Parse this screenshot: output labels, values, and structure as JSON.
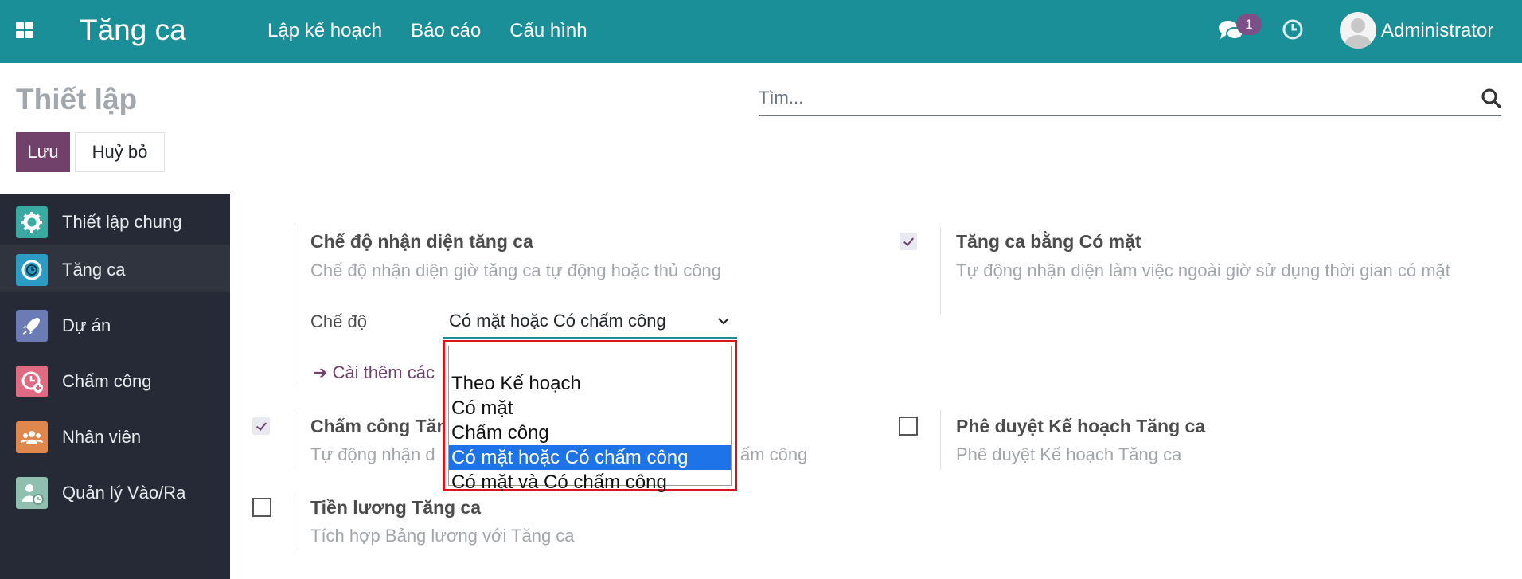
{
  "navbar": {
    "app_title": "Tăng ca",
    "menu": [
      "Lập kế hoạch",
      "Báo cáo",
      "Cấu hình"
    ],
    "chat_badge_count": "1",
    "user_name": "Administrator",
    "color": "#1b8f97"
  },
  "control_panel": {
    "title": "Thiết lập",
    "search_placeholder": "Tìm...",
    "save_label": "Lưu",
    "discard_label": "Huỷ bỏ"
  },
  "sidebar": {
    "items": [
      {
        "label": "Thiết lập chung",
        "icon": "gear-icon",
        "color": "#3aa9a2"
      },
      {
        "label": "Tăng ca",
        "icon": "overtime-clock-icon",
        "color": "#2c9cc4"
      },
      {
        "label": "Dự án",
        "icon": "rocket-icon",
        "color": "#6b7bb5"
      },
      {
        "label": "Chấm công",
        "icon": "timesheet-icon",
        "color": "#e06a82"
      },
      {
        "label": "Nhân viên",
        "icon": "employees-icon",
        "color": "#e0874d"
      },
      {
        "label": "Quản lý Vào/Ra",
        "icon": "attendance-icon",
        "color": "#8fbfae"
      }
    ],
    "active": "Tăng ca"
  },
  "settings": {
    "recognition_mode": {
      "title": "Chế độ nhận diện tăng ca",
      "description": "Chế độ nhận diện giờ tăng ca tự động hoặc thủ công",
      "field_label": "Chế độ",
      "selected_value": "Có mặt hoặc Có chấm công",
      "link_text": "Cài thêm các"
    },
    "overtime_by_attendance": {
      "title": "Tăng ca bằng Có mặt",
      "description": "Tự động nhận diện làm việc ngoài giờ sử dụng thời gian có mặt",
      "checked": true
    },
    "overtime_by_timesheet": {
      "title": "Chấm công Tăng",
      "description_left": "Tự động nhận d",
      "description_right": "ấm công",
      "checked": true
    },
    "approve_plan": {
      "title": "Phê duyệt Kế hoạch Tăng ca",
      "description": "Phê duyệt Kế hoạch Tăng ca",
      "checked": false
    },
    "payroll": {
      "title": "Tiền lương Tăng ca",
      "description": "Tích hợp Bảng lương với Tăng ca",
      "checked": false
    }
  },
  "dropdown": {
    "options": [
      "",
      "Theo Kế hoạch",
      "Có mặt",
      "Chấm công",
      "Có mặt hoặc Có chấm công",
      "Có mặt và Có chấm công"
    ],
    "selected_index": 4,
    "highlight_color": "#d9141c"
  }
}
